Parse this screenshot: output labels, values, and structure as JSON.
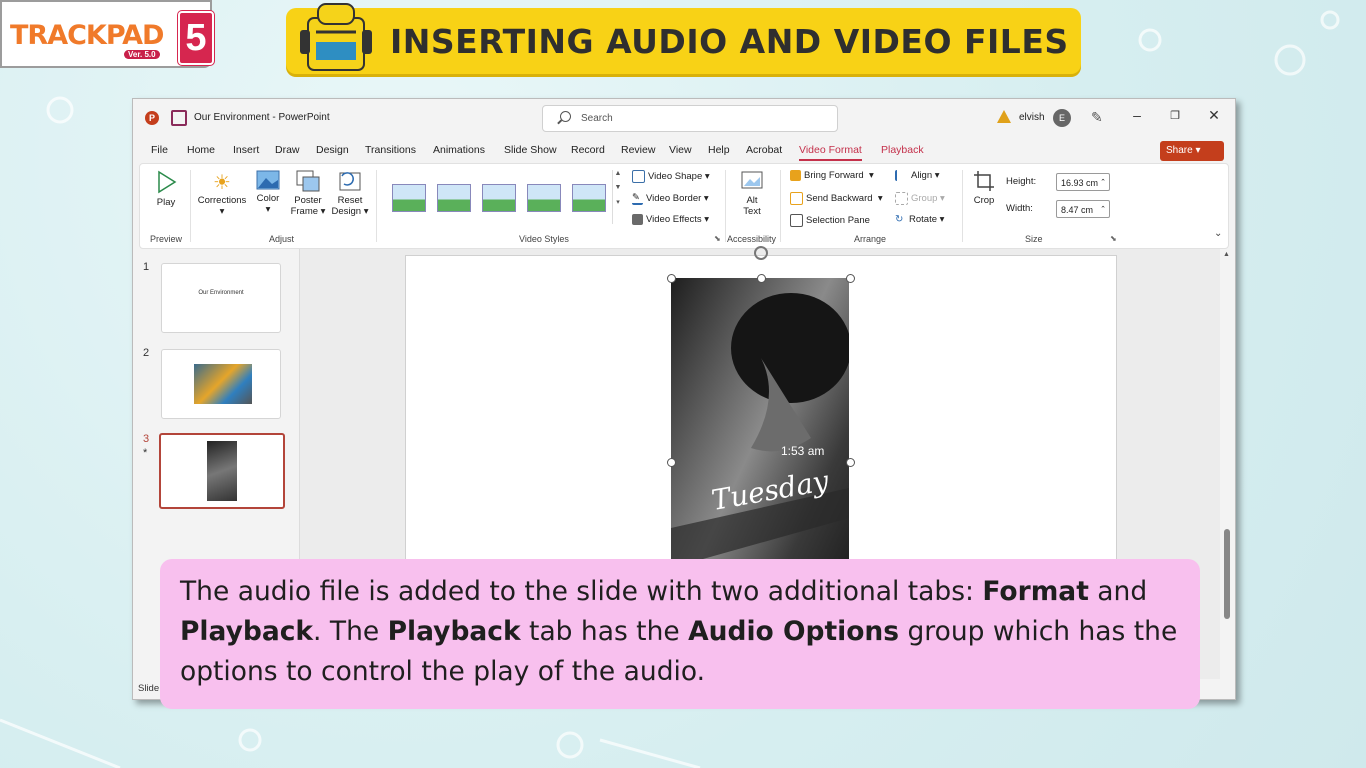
{
  "brand": {
    "logo_text": "TRACKPAD",
    "version": "Ver. 5.0",
    "number": "5"
  },
  "banner": {
    "title": "INSERTING AUDIO AND VIDEO FILES"
  },
  "window": {
    "doc_title": "Our Environment  -  PowerPoint",
    "search_placeholder": "Search",
    "user": "elvish",
    "avatar_letter": "E",
    "controls": {
      "minimize": "–",
      "restore": "❐",
      "close": "✕"
    }
  },
  "tabs": [
    "File",
    "Home",
    "Insert",
    "Draw",
    "Design",
    "Transitions",
    "Animations",
    "Slide Show",
    "Record",
    "Review",
    "View",
    "Help",
    "Acrobat",
    "Video Format",
    "Playback"
  ],
  "share_label": "Share",
  "ribbon": {
    "preview": {
      "play": "Play",
      "group": "Preview"
    },
    "adjust": {
      "corrections": "Corrections",
      "color": "Color",
      "poster1": "Poster",
      "poster2": "Frame",
      "reset1": "Reset",
      "reset2": "Design",
      "group": "Adjust"
    },
    "video_styles": {
      "shape": "Video Shape",
      "border": "Video Border",
      "effects": "Video Effects",
      "group": "Video Styles"
    },
    "accessibility": {
      "alt1": "Alt",
      "alt2": "Text",
      "group": "Accessibility"
    },
    "arrange": {
      "bring_forward": "Bring Forward",
      "send_backward": "Send Backward",
      "selection_pane": "Selection Pane",
      "align": "Align",
      "group_btn": "Group",
      "rotate": "Rotate",
      "group": "Arrange"
    },
    "size": {
      "crop": "Crop",
      "height_label": "Height:",
      "height_value": "16.93 cm",
      "width_label": "Width:",
      "width_value": "8.47 cm",
      "group": "Size"
    }
  },
  "slides": [
    {
      "num": "1",
      "title": "Our Environment"
    },
    {
      "num": "2"
    },
    {
      "num": "3",
      "star": "*"
    }
  ],
  "video": {
    "time": "1:53 am",
    "script": "Tuesday"
  },
  "status": {
    "left": "Slide"
  },
  "caption": {
    "p1": "The audio file is added to the slide with two additional tabs: ",
    "b1": "Format",
    "p2": " and ",
    "b2": "Playback",
    "p3": ". The ",
    "b3": "Playback",
    "p4": " tab has the ",
    "b4": "Audio Options",
    "p5": " group which has the options to control the play of the audio."
  }
}
